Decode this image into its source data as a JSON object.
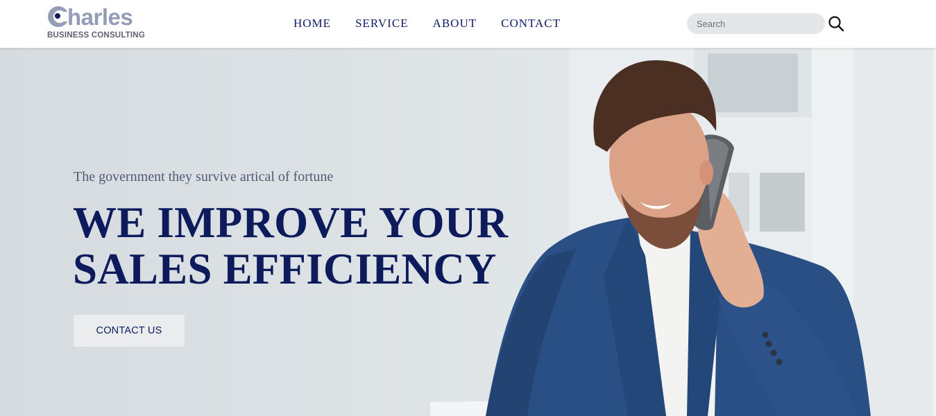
{
  "header": {
    "logo": {
      "word": "harles",
      "subtitle": "BUSINESS CONSULTING"
    },
    "nav": [
      {
        "label": "HOME"
      },
      {
        "label": "SERVICE"
      },
      {
        "label": "ABOUT"
      },
      {
        "label": "CONTACT"
      }
    ],
    "search": {
      "placeholder": "Search",
      "icon": "search-icon"
    }
  },
  "hero": {
    "tagline": "The government they survive artical of fortune",
    "headline_line1": "WE IMPROVE YOUR",
    "headline_line2": "SALES EFFICIENCY",
    "cta_label": "CONTACT US",
    "image": "businessman-on-phone-photo"
  },
  "colors": {
    "brand_navy": "#0d1b5c",
    "nav_text": "#0f1a6b",
    "logo_gray": "#959db6",
    "hero_bg": "#dde2e5",
    "suit_blue": "#2a4f85"
  }
}
